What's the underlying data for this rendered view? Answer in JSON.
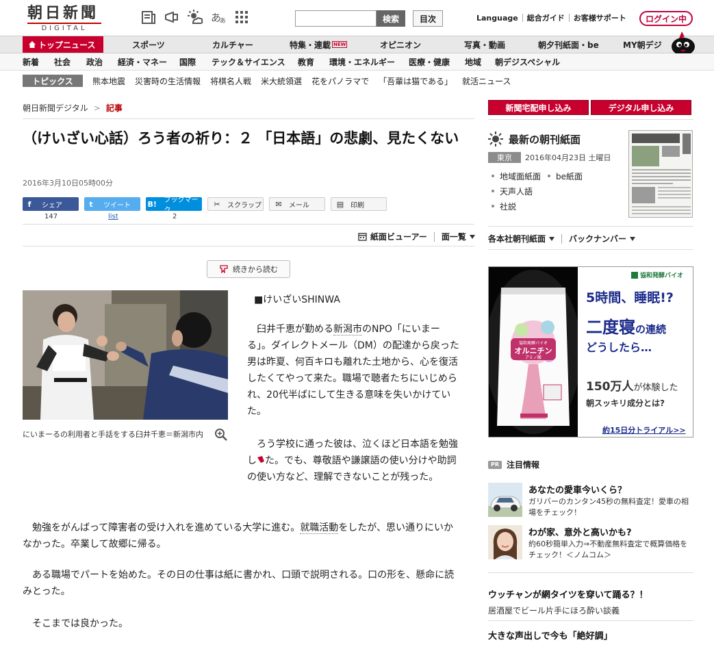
{
  "header": {
    "logo_main": "朝日新聞",
    "logo_sub": "DIGITAL",
    "search_button": "検索",
    "index_button": "目次",
    "links": [
      "Language",
      "総合ガイド",
      "お客様サポート"
    ],
    "login_button": "ログイン中",
    "icons": [
      "news-icon",
      "megaphone-icon",
      "weather-icon",
      "font-size-icon",
      "grid-menu-icon"
    ]
  },
  "mainnav": {
    "items": [
      "トップニュース",
      "スポーツ",
      "カルチャー",
      "特集・連載",
      "オピニオン",
      "写真・動画",
      "朝夕刊紙面・be",
      "MY朝デジ"
    ],
    "new_badge": "NEW"
  },
  "subnav": {
    "items": [
      "新着",
      "社会",
      "政治",
      "経済・マネー",
      "国際",
      "テック＆サイエンス",
      "教育",
      "環境・エネルギー",
      "医療・健康",
      "地域",
      "朝デジスペシャル"
    ]
  },
  "topics": {
    "label": "トピックス",
    "items": [
      "熊本地震",
      "災害時の生活情報",
      "将棋名人戦",
      "米大統領選",
      "花をパノラマで",
      "「吾輩は猫である」",
      "就活ニュース"
    ]
  },
  "article": {
    "breadcrumb_home": "朝日新聞デジタル",
    "breadcrumb_current": "記事",
    "headline": "（けいざい心話）ろう者の祈り：２ 「日本語」の悲劇、見たくない",
    "timestamp": "2016年3月10日05時00分",
    "share": [
      {
        "icon": "facebook-icon",
        "glyph": "f",
        "label": "シェア",
        "count": "147"
      },
      {
        "icon": "twitter-icon",
        "glyph": "t",
        "label": "ツイート",
        "count": "list"
      },
      {
        "icon": "hatena-bookmark-icon",
        "glyph": "B!",
        "label": "ブックマーク",
        "count": "2"
      },
      {
        "icon": "scissors-icon",
        "glyph": "✂",
        "label": "スクラップ"
      },
      {
        "icon": "mail-icon",
        "glyph": "✉",
        "label": "メール"
      },
      {
        "icon": "print-icon",
        "glyph": "▤",
        "label": "印刷"
      }
    ],
    "viewer_label": "紙面ビューアー",
    "list_label": "面一覧",
    "readmore_label": "続きから読む",
    "photo_caption": "にいまーるの利用者と手話をする臼井千恵＝新潟市内",
    "column_label": "■けいざいSHINWA",
    "p1_a": "臼井千恵が勤める",
    "p1_kw": "新潟市",
    "p1_b": "のNPO「にいまーる」。ダイレクトメール（DM）の配達から戻った男は昨夏、何百キロも離れた土地から、心を復活したくてやって来た。職場で聴者たちにいじめられ、20代半ばにして生きる意味を失いかけていた。",
    "p2_a": "ろう学校に通った彼は、泣くほど日本語を勉強し",
    "p2_b": "た。でも、尊敬語や謙譲語の使い分けや助詞の使い方など、理解できないことが残った。",
    "p3_a": "勉強をがんばって障害者の受け入れを進めている大学に進む。",
    "p3_kw": "就職活動",
    "p3_b": "をしたが、思い通りにいかなかった。卒業して故郷に帰る。",
    "p4": "ある職場でパートを始めた。その日の仕事は紙に書かれ、口頭で説明される。口の形を、懸命に読みとった。",
    "p5": "そこまでは良かった。"
  },
  "sidebar": {
    "subscribe_home": "新聞宅配申し込み",
    "subscribe_digital": "デジタル申し込み",
    "paper_title": "最新の朝刊紙面",
    "region": "東京",
    "paper_date": "2016年04月23日 土曜日",
    "paper_links": [
      "地域面紙面",
      "be紙面",
      "天声人語",
      "社説"
    ],
    "paper_tool_1": "各本社朝刊紙面",
    "paper_tool_2": "バックナンバー",
    "ad": {
      "brand": "協和発酵バイオ",
      "line1": "5時間、睡眠!?",
      "line2_big": "二度寝",
      "line2_small": "の連続",
      "line3": "どうしたら…",
      "line4_big": "150万人",
      "line4_small": "が体験した",
      "line5": "朝スッキリ成分とは?",
      "cta": "約15日分トライアル>>",
      "product_brand": "協和発酵バイオ",
      "product_name": "オルニチン",
      "product_sub": "アミノ酸"
    },
    "pr_badge": "PR",
    "pr_heading": "注目情報",
    "pr_items": [
      {
        "title": "あなたの愛車今いくら？",
        "desc": "ガリバーのカンタン45秒の無料査定！愛車の相場をチェック！"
      },
      {
        "title": "わが家、意外と高いかも?",
        "desc": "約60秒簡単入力⇒不動産無料査定で概算価格をチェック！＜ノムコム＞"
      }
    ],
    "ext_items": [
      {
        "title": "ウッチャンが網タイツを穿いて踊る？！",
        "desc": "居酒屋でビール片手にほろ酔い談義"
      },
      {
        "title": "大きな声出しで今も「絶好調」",
        "desc": ""
      }
    ]
  },
  "colors": {
    "accent_red": "#c8002d",
    "facebook": "#3b5998",
    "twitter": "#55acee",
    "hatena": "#008fde",
    "ad_navy": "#1a2a8a"
  }
}
